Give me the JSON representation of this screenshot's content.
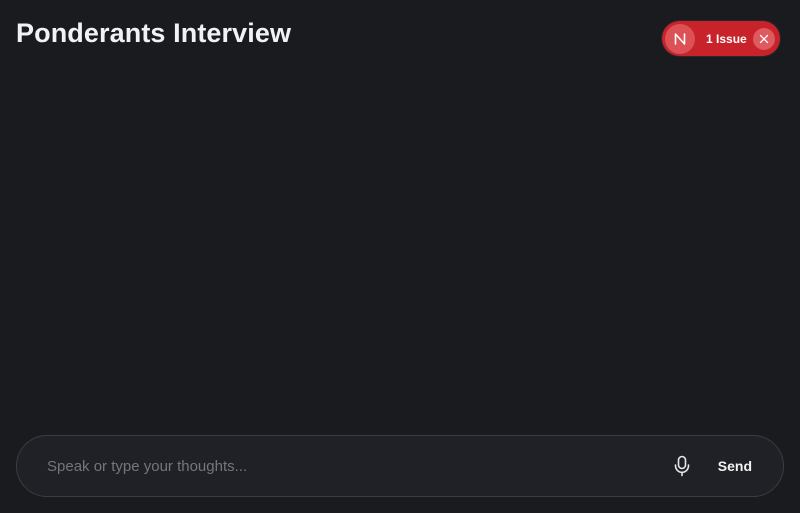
{
  "header": {
    "title": "Ponderants Interview"
  },
  "dev_indicator": {
    "badge_letter": "N",
    "issues_label": "1 Issue",
    "close_icon": "close-icon",
    "colors": {
      "pill": "#c8222b",
      "badge": "#dc5156"
    }
  },
  "composer": {
    "placeholder": "Speak or type your thoughts...",
    "value": "",
    "mic_icon": "microphone-icon",
    "send_label": "Send"
  },
  "theme": {
    "background": "#1a1b1f",
    "input_background": "#202126",
    "input_border": "#3c3d44"
  }
}
